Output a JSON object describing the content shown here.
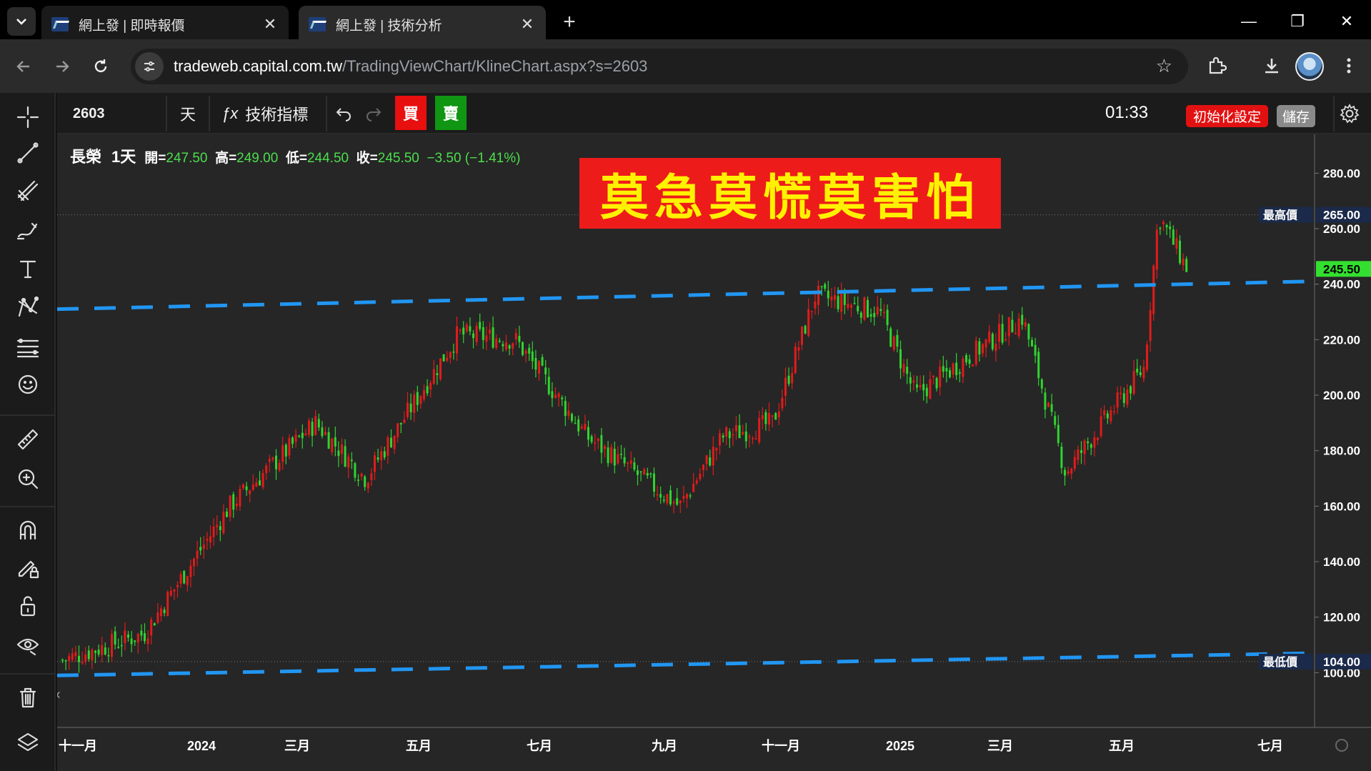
{
  "browser": {
    "tabs": [
      {
        "title": "網上發 | 即時報價",
        "close": "✕"
      },
      {
        "title": "網上發 | 技術分析",
        "close": "✕"
      }
    ],
    "new_tab": "+",
    "url_host": "tradeweb.capital.com.tw",
    "url_path": "/TradingViewChart/KlineChart.aspx?s=2603",
    "window_controls": {
      "minimize": "—",
      "restore": "❐",
      "close": "✕"
    }
  },
  "chart_toolbar": {
    "symbol": "2603",
    "interval": "天",
    "fx_icon": "ƒx",
    "indicators": "技術指標",
    "buy": "買",
    "sell": "賣",
    "clock": "01:33",
    "reset": "初始化設定",
    "save": "儲存"
  },
  "legend": {
    "name": "長榮",
    "interval": "1天",
    "open_label": "開=",
    "open": "247.50",
    "high_label": "高=",
    "high": "249.00",
    "low_label": "低=",
    "low": "244.50",
    "close_label": "收=",
    "close": "245.50",
    "change": "−3.50 (−1.41%)"
  },
  "banner_text": "莫急莫慌莫害怕",
  "colors": {
    "up": "#e01b1b",
    "down": "#2fd42f",
    "trendline": "#2196f3",
    "banner_bg": "#ee1b1b",
    "banner_text": "#fff200"
  },
  "chart_data": {
    "type": "candlestick",
    "symbol": "2603",
    "name": "長榮",
    "interval": "1天",
    "ylim": [
      88,
      294
    ],
    "y_ticks": [
      100,
      120,
      140,
      160,
      180,
      200,
      220,
      240,
      260,
      280
    ],
    "x_ticks": [
      "十一月",
      "2024",
      "三月",
      "五月",
      "七月",
      "九月",
      "十一月",
      "2025",
      "三月",
      "五月",
      "七月"
    ],
    "last_price": "245.50",
    "highest_label": "最高價",
    "highest": "265.00",
    "lowest_label": "最低價",
    "lowest": "104.00",
    "trendlines": [
      {
        "from": {
          "x": "十一月 2023",
          "y": 231
        },
        "to": {
          "x": "七月 2025",
          "y": 241
        },
        "style": "dashed"
      },
      {
        "from": {
          "x": "十一月 2023",
          "y": 99
        },
        "to": {
          "x": "七月 2025",
          "y": 107
        },
        "style": "dashed"
      }
    ],
    "price_path_anchors": [
      {
        "x": "十一月 2023",
        "close": 104
      },
      {
        "x": "十二月 2023",
        "close": 114
      },
      {
        "x": "2024",
        "close": 160
      },
      {
        "x": "三月",
        "close": 190
      },
      {
        "x": "四月",
        "close": 170
      },
      {
        "x": "五月",
        "close": 222
      },
      {
        "x": "六月",
        "close": 220
      },
      {
        "x": "七月",
        "close": 185
      },
      {
        "x": "八月",
        "close": 160
      },
      {
        "x": "九月",
        "close": 185
      },
      {
        "x": "十月",
        "close": 190
      },
      {
        "x": "十一月",
        "close": 236
      },
      {
        "x": "十二月",
        "close": 230
      },
      {
        "x": "2025",
        "close": 200
      },
      {
        "x": "三月",
        "close": 228
      },
      {
        "x": "四月",
        "close": 172
      },
      {
        "x": "五月",
        "close": 210
      },
      {
        "x": "五月下旬",
        "close": 265
      },
      {
        "x": "六月",
        "close": 245.5
      }
    ]
  }
}
